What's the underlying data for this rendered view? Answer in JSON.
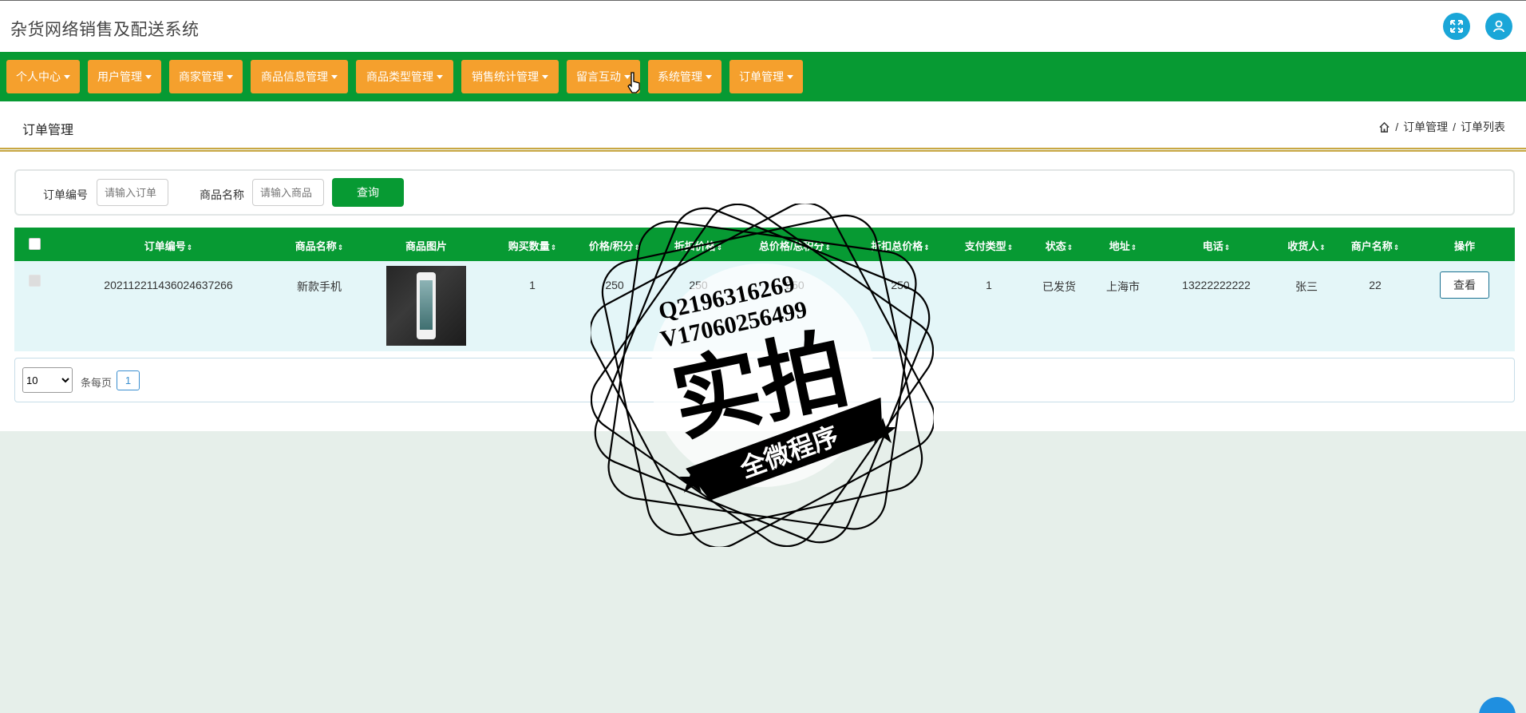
{
  "header": {
    "title": "杂货网络销售及配送系统",
    "fullscreen_icon": "expand-icon",
    "user_icon": "user-icon"
  },
  "nav": {
    "items": [
      {
        "label": "个人中心"
      },
      {
        "label": "用户管理"
      },
      {
        "label": "商家管理"
      },
      {
        "label": "商品信息管理"
      },
      {
        "label": "商品类型管理"
      },
      {
        "label": "销售统计管理"
      },
      {
        "label": "留言互动"
      },
      {
        "label": "系统管理"
      },
      {
        "label": "订单管理"
      }
    ]
  },
  "page": {
    "title": "订单管理",
    "breadcrumb": [
      "订单管理",
      "订单列表"
    ],
    "breadcrumb_sep": "/"
  },
  "search": {
    "order_no_label": "订单编号",
    "order_no_placeholder": "请输入订单",
    "product_name_label": "商品名称",
    "product_name_placeholder": "请输入商品",
    "query_button": "查询"
  },
  "table": {
    "columns": [
      "订单编号",
      "商品名称",
      "商品图片",
      "购买数量",
      "价格/积分",
      "折扣价格",
      "总价格/总积分",
      "折扣总价格",
      "支付类型",
      "状态",
      "地址",
      "电话",
      "收货人",
      "商户名称",
      "操作"
    ],
    "rows": [
      {
        "order_no": "202112211436024637266",
        "product_name": "新款手机",
        "quantity": "1",
        "price": "250",
        "discount_price": "250",
        "total_price": "250",
        "discount_total": "250",
        "pay_type": "1",
        "status": "已发货",
        "address": "上海市",
        "phone": "13222222222",
        "receiver": "张三",
        "merchant": "22",
        "action": "查看"
      }
    ]
  },
  "pagination": {
    "page_size": "10",
    "page_size_options": [
      "10"
    ],
    "per_page_label": "条每页",
    "current_page": "1"
  },
  "watermark": {
    "line1": "Q2196316269",
    "line2": "V17060256499",
    "main": "实拍",
    "banner": "全微程序"
  },
  "colors": {
    "nav_bg": "#079a33",
    "nav_item": "#f5a02d",
    "table_row": "#e4f6f8",
    "icon_circle": "#1aa6d8"
  }
}
